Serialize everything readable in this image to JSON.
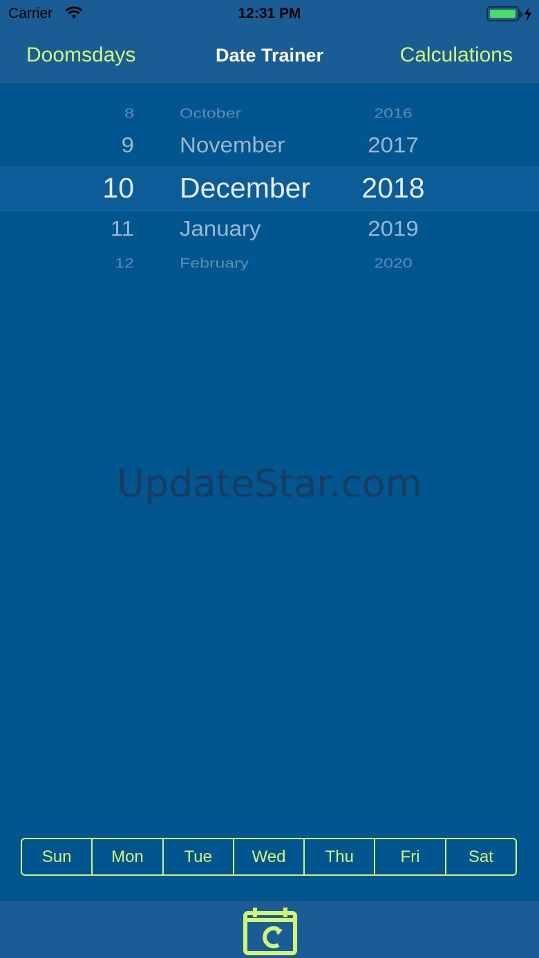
{
  "status": {
    "carrier": "Carrier",
    "time": "12:31 PM",
    "battery_level": 1.0
  },
  "nav": {
    "left_button": "Doomsdays",
    "title": "Date Trainer",
    "right_button": "Calculations"
  },
  "picker": {
    "days": [
      "8",
      "9",
      "10",
      "11",
      "12"
    ],
    "months": [
      "October",
      "November",
      "December",
      "January",
      "February"
    ],
    "years": [
      "2016",
      "2017",
      "2018",
      "2019",
      "2020"
    ],
    "selected": {
      "day": "10",
      "month": "December",
      "year": "2018"
    }
  },
  "watermark": "UpdateStar.com",
  "weekdays": [
    "Sun",
    "Mon",
    "Tue",
    "Wed",
    "Thu",
    "Fri",
    "Sat"
  ],
  "tab_bar": {
    "icon": "calendar-refresh-icon"
  },
  "colors": {
    "background": "#02568f",
    "bar": "#1a5d94",
    "accent": "#d3f577"
  }
}
